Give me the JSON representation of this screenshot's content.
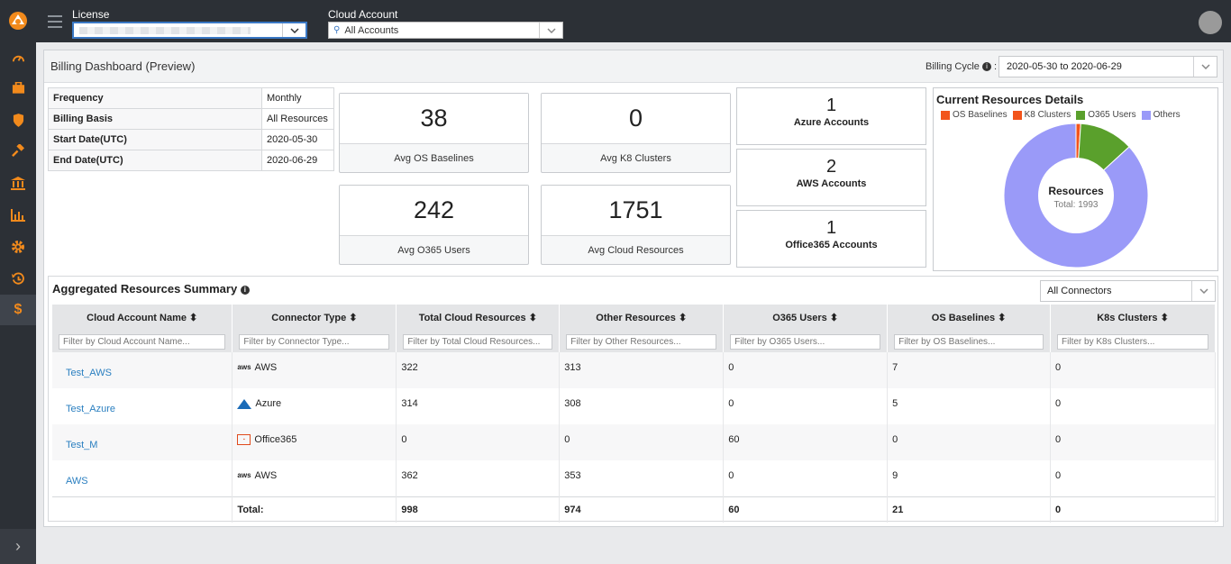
{
  "header": {
    "license_label": "License",
    "license_value": "",
    "cloud_account_label": "Cloud Account",
    "cloud_account_value": "All Accounts"
  },
  "sidebar": {
    "icons": [
      "dashboard-icon",
      "briefcase-icon",
      "shield-icon",
      "gavel-icon",
      "bank-icon",
      "bar-chart-icon",
      "gear-icon",
      "history-icon",
      "dollar-icon"
    ],
    "active": "dollar-icon",
    "expand_icon": "chevron-right-icon"
  },
  "dashboard": {
    "title": "Billing Dashboard (Preview)",
    "billing_cycle_label": "Billing Cycle",
    "billing_cycle_value": "2020-05-30 to 2020-06-29"
  },
  "info": [
    {
      "key": "Frequency",
      "value": "Monthly"
    },
    {
      "key": "Billing Basis",
      "value": "All Resources"
    },
    {
      "key": "Start Date(UTC)",
      "value": "2020-05-30"
    },
    {
      "key": "End Date(UTC)",
      "value": "2020-06-29"
    }
  ],
  "cards": {
    "os_baselines": {
      "value": "38",
      "label": "Avg OS Baselines"
    },
    "k8_clusters": {
      "value": "0",
      "label": "Avg K8 Clusters"
    },
    "o365_users": {
      "value": "242",
      "label": "Avg O365 Users"
    },
    "cloud_resources": {
      "value": "1751",
      "label": "Avg Cloud Resources"
    }
  },
  "accounts": {
    "azure": {
      "value": "1",
      "label": "Azure Accounts"
    },
    "aws": {
      "value": "2",
      "label": "AWS Accounts"
    },
    "office365": {
      "value": "1",
      "label": "Office365 Accounts"
    }
  },
  "chart_data": {
    "type": "pie",
    "title": "Current Resources Details",
    "center_label": "Resources",
    "center_sub": "Total: 1993",
    "legend_position": "top",
    "categories": [
      "OS Baselines",
      "K8 Clusters",
      "O365 Users",
      "Others"
    ],
    "values": [
      21,
      0,
      242,
      1730
    ],
    "colors": [
      "#f2541b",
      "#f2541b",
      "#5aa02c",
      "#9a9af8"
    ]
  },
  "summary": {
    "title": "Aggregated Resources Summary",
    "connector_filter": "All Connectors",
    "columns": [
      "Cloud Account Name",
      "Connector Type",
      "Total Cloud Resources",
      "Other Resources",
      "O365 Users",
      "OS Baselines",
      "K8s Clusters"
    ],
    "filter_placeholders": [
      "Filter by Cloud Account Name...",
      "Filter by Connector Type...",
      "Filter by Total Cloud Resources...",
      "Filter by Other Resources...",
      "Filter by O365 Users...",
      "Filter by OS Baselines...",
      "Filter by K8s Clusters..."
    ],
    "rows": [
      {
        "account": "Test_AWS",
        "type": "AWS",
        "icon": "aws",
        "total": "322",
        "other": "313",
        "o365": "0",
        "os": "7",
        "k8s": "0"
      },
      {
        "account": "Test_Azure",
        "type": "Azure",
        "icon": "azure",
        "total": "314",
        "other": "308",
        "o365": "0",
        "os": "5",
        "k8s": "0"
      },
      {
        "account": "Test_M",
        "type": "Office365",
        "icon": "office365",
        "total": "0",
        "other": "0",
        "o365": "60",
        "os": "0",
        "k8s": "0"
      },
      {
        "account": "AWS",
        "type": "AWS",
        "icon": "aws",
        "total": "362",
        "other": "353",
        "o365": "0",
        "os": "9",
        "k8s": "0"
      }
    ],
    "totals": {
      "label": "Total:",
      "total": "998",
      "other": "974",
      "o365": "60",
      "os": "21",
      "k8s": "0"
    }
  }
}
